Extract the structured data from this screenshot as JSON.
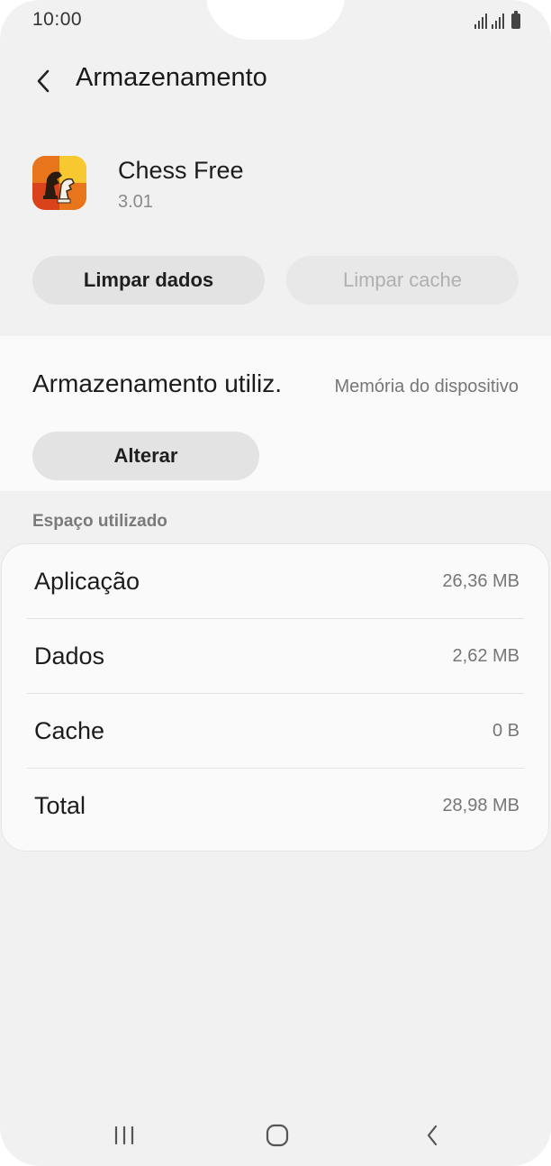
{
  "status_bar": {
    "time": "10:00"
  },
  "header": {
    "title": "Armazenamento"
  },
  "app": {
    "name": "Chess Free",
    "version": "3.01"
  },
  "actions": {
    "clear_data": "Limpar dados",
    "clear_cache": "Limpar cache"
  },
  "storage": {
    "label": "Armazenamento utiliz.",
    "value": "Memória do dispositivo",
    "change_button": "Alterar"
  },
  "space_used": {
    "title": "Espaço utilizado",
    "rows": [
      {
        "label": "Aplicação",
        "value": "26,36 MB"
      },
      {
        "label": "Dados",
        "value": "2,62 MB"
      },
      {
        "label": "Cache",
        "value": "0 B"
      },
      {
        "label": "Total",
        "value": "28,98 MB"
      }
    ]
  },
  "nav_icons": [
    "recent-apps-icon",
    "home-icon",
    "back-icon"
  ],
  "colors": {
    "background": "#f1f1f1",
    "card": "#fafafa",
    "button": "#e3e3e3",
    "muted": "#767676"
  }
}
